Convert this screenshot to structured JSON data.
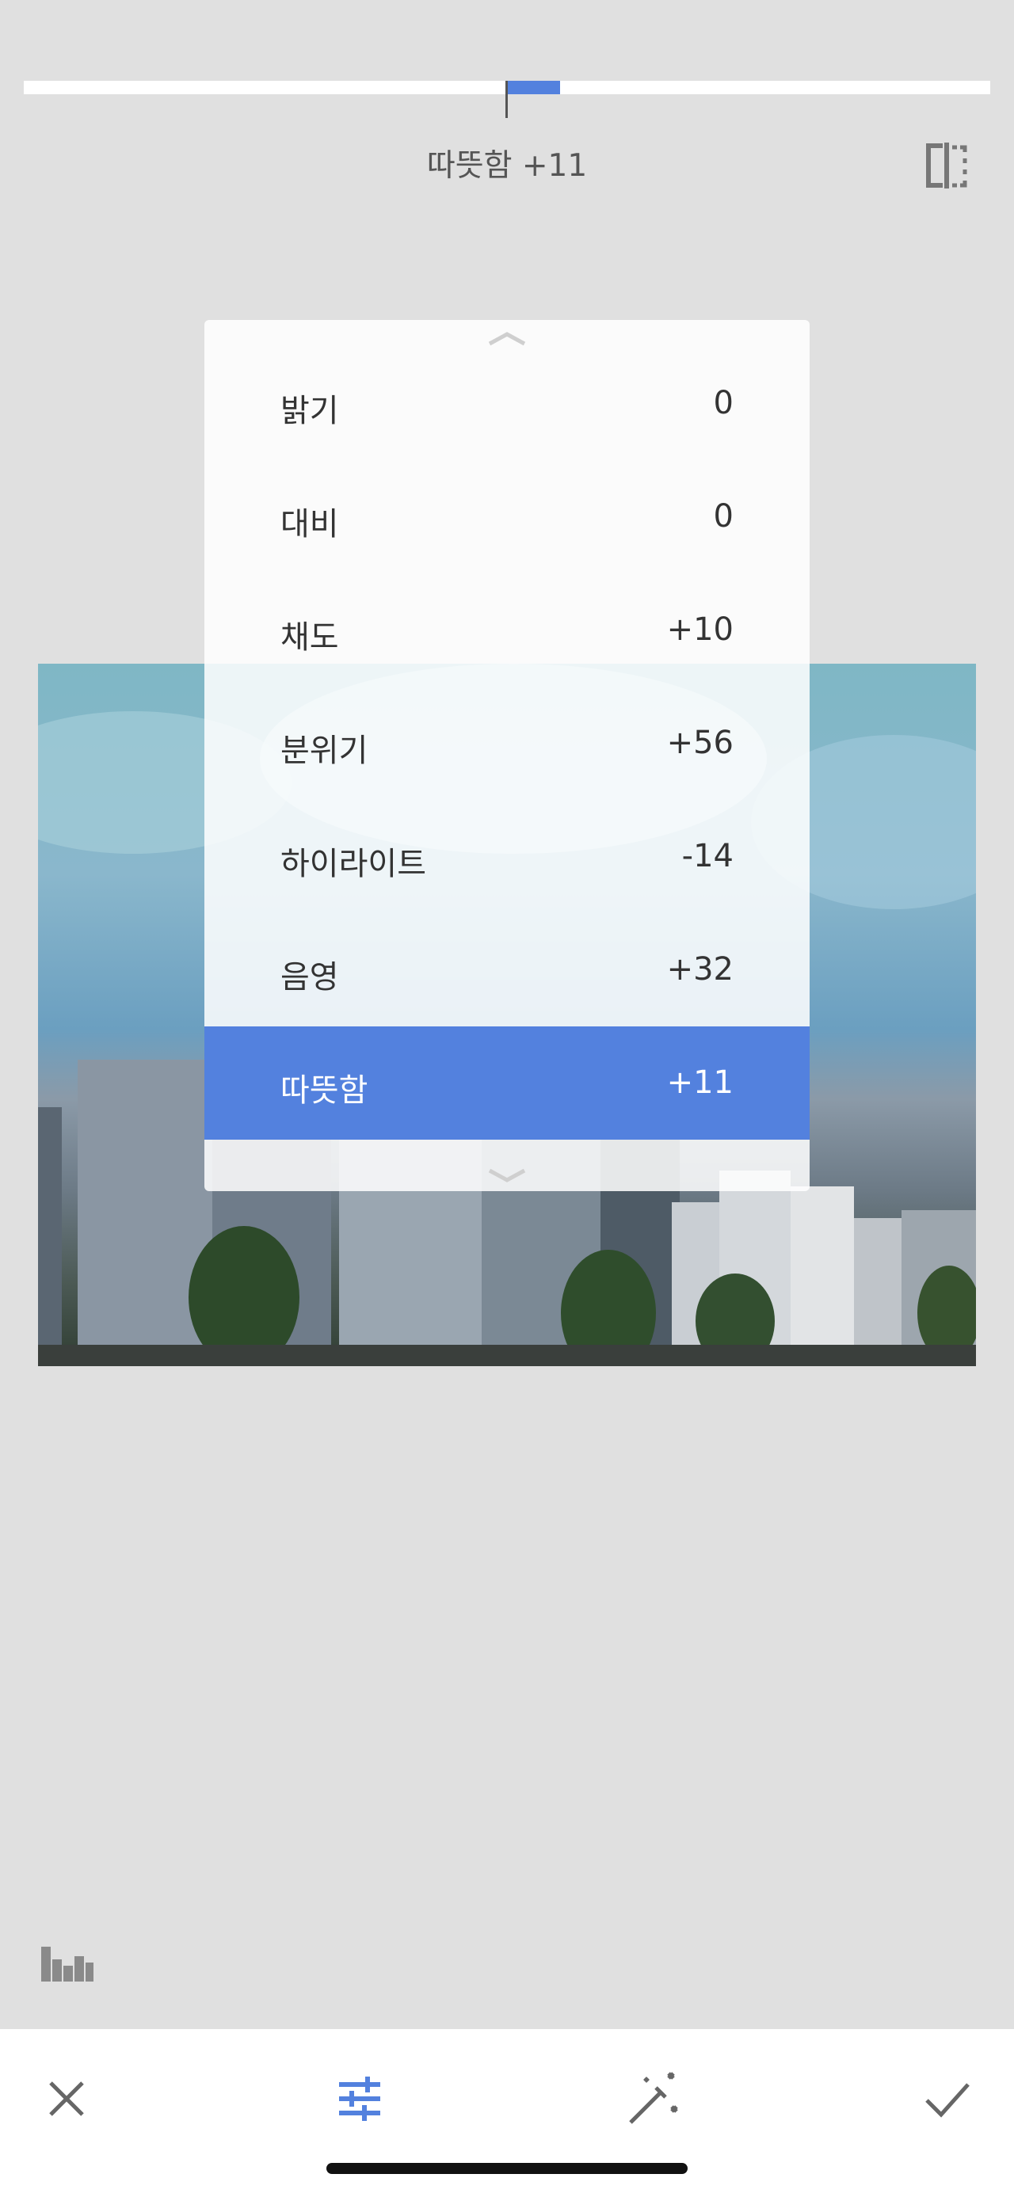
{
  "adjustment": {
    "status_label": "따뜻함 +11",
    "slider_value": 11,
    "slider_min": -100,
    "slider_max": 100
  },
  "menu": {
    "items": [
      {
        "label": "밝기",
        "value": "0"
      },
      {
        "label": "대비",
        "value": "0"
      },
      {
        "label": "채도",
        "value": "+10"
      },
      {
        "label": "분위기",
        "value": "+56"
      },
      {
        "label": "하이라이트",
        "value": "-14"
      },
      {
        "label": "음영",
        "value": "+32"
      },
      {
        "label": "따뜻함",
        "value": "+11"
      }
    ],
    "selected_index": 6
  },
  "icons": {
    "compare": "compare-split-icon",
    "histogram": "histogram-icon",
    "cancel": "close-icon",
    "tune": "sliders-icon",
    "auto": "magic-wand-icon",
    "apply": "check-icon"
  },
  "colors": {
    "accent": "#5381de",
    "background": "#e0e0e0",
    "toolbar": "#ffffff"
  }
}
